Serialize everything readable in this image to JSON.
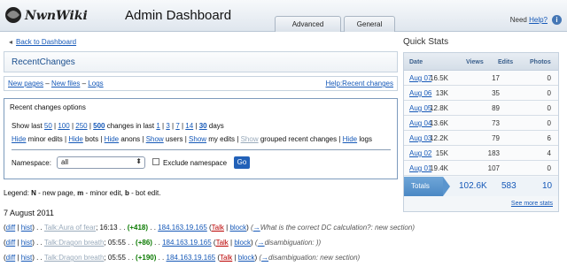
{
  "header": {
    "logo_text": "NwnWiki",
    "title": "Admin Dashboard",
    "tabs": [
      {
        "label": "Advanced"
      },
      {
        "label": "General"
      }
    ],
    "need_help_prefix": "Need ",
    "help_link": "Help?",
    "help_icon_glyph": "i"
  },
  "nav": {
    "back_glyph": "◂",
    "back_label": "Back to Dashboard"
  },
  "recent": {
    "title": "RecentChanges",
    "links": [
      "New pages",
      "New files",
      "Logs"
    ],
    "link_sep": " – ",
    "help_link": "Help:Recent changes"
  },
  "options": {
    "legend": "Recent changes options",
    "show_last": "Show last",
    "counts": [
      "50",
      "100",
      "250",
      "500"
    ],
    "changes_in_last": "changes in last",
    "days": [
      "1",
      "3",
      "7",
      "14",
      "30"
    ],
    "days_label": "days",
    "row2": [
      {
        "link": "Hide",
        "text": " minor edits"
      },
      {
        "link": "Hide",
        "text": " bots"
      },
      {
        "link": "Hide",
        "text": " anons"
      },
      {
        "link": "Show",
        "text": " users"
      },
      {
        "link": "Show",
        "text": " my edits"
      },
      {
        "link": "Show",
        "text": " grouped recent changes",
        "disabled": true
      },
      {
        "link": "Hide",
        "text": " logs"
      }
    ],
    "namespace_label": "Namespace:",
    "namespace_value": "all",
    "namespace_caret": "⬍",
    "exclude_label": "Exclude namespace",
    "go_label": "Go"
  },
  "legend_text": {
    "prefix": "Legend: ",
    "n": "N",
    "n_text": " - new page, ",
    "m": "m",
    "m_text": " - minor edit, ",
    "b": "b",
    "b_text": " - bot edit."
  },
  "date_heading": "7 August 2011",
  "entries": [
    {
      "page": "Talk:Aura of fear",
      "time": "16:13",
      "delta": "(+418)",
      "ip": "184.163.19.165",
      "comment": "What is the correct DC calculation?: new section"
    },
    {
      "page": "Talk:Dragon breath",
      "time": "05:55",
      "delta": "(+86)",
      "ip": "184.163.19.165",
      "comment": "disambiguation: )"
    },
    {
      "page": "Talk:Dragon breath",
      "time": "05:55",
      "delta": "(+190)",
      "ip": "184.163.19.165",
      "comment": "disambiguation: new section"
    }
  ],
  "entry_strings": {
    "diff": "diff",
    "hist": "hist",
    "talk": "Talk",
    "block": "block",
    "arrow": "→"
  },
  "quick_stats": {
    "title": "Quick Stats",
    "headers": [
      "Date",
      "Views",
      "Edits",
      "Photos"
    ],
    "rows": [
      {
        "date": "Aug 07",
        "views": "16.5K",
        "edits": "17",
        "photos": "0"
      },
      {
        "date": "Aug 06",
        "views": "13K",
        "edits": "35",
        "photos": "0"
      },
      {
        "date": "Aug 05",
        "views": "12.8K",
        "edits": "89",
        "photos": "0"
      },
      {
        "date": "Aug 04",
        "views": "13.6K",
        "edits": "73",
        "photos": "0"
      },
      {
        "date": "Aug 03",
        "views": "12.2K",
        "edits": "79",
        "photos": "6"
      },
      {
        "date": "Aug 02",
        "views": "15K",
        "edits": "183",
        "photos": "4"
      },
      {
        "date": "Aug 01",
        "views": "19.4K",
        "edits": "107",
        "photos": "0"
      }
    ],
    "totals": {
      "label": "Totals",
      "views": "102.6K",
      "edits": "583",
      "photos": "10"
    },
    "see_more": "See more stats"
  },
  "colors": {
    "accent": "#1659b8",
    "go_button": "#2261b8",
    "added": "#0a7a00",
    "talk_red": "#ba0000"
  }
}
